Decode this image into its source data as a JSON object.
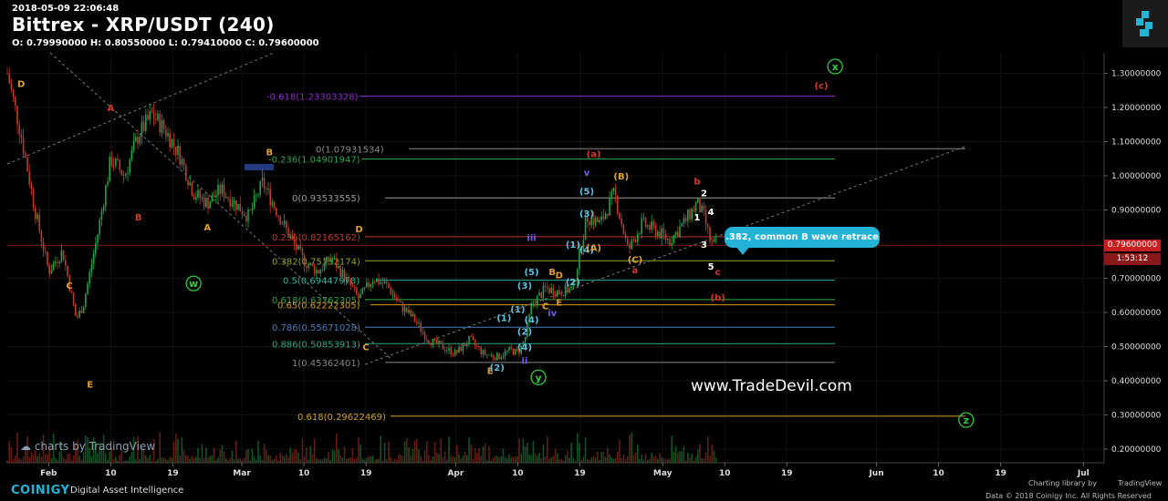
{
  "header": {
    "timestamp": "2018-05-09 22:06:48",
    "title": "Bittrex - XRP/USDT (240)",
    "ohlc": "O: 0.79990000 H: 0.80550000 L: 0.79410000 C: 0.79600000"
  },
  "footer": {
    "brand": "COINIGY",
    "tagline": "Digital Asset Intelligence",
    "charting_by": "Charting library by",
    "tradingview": "TradingView",
    "copyright": "Data © 2018 Coinigy Inc. All Rights Reserved"
  },
  "watermark": "charts by TradingView",
  "site": "www.TradeDevil.com",
  "callout": ".382, common B wave retrace",
  "current_price": {
    "label": "0.79600000",
    "countdown": "1:53:12"
  },
  "colors": {
    "up": "#1fa34a",
    "down": "#c0392b",
    "accent": "#23b3d7",
    "price_line": "#c71f1f"
  },
  "chart_data": {
    "type": "candlestick",
    "y_axis": {
      "min": 0.16,
      "max": 1.36,
      "ticks": [
        "1.30000000",
        "1.20000000",
        "1.10000000",
        "1.00000000",
        "0.90000000",
        "0.80000000",
        "0.70000000",
        "0.60000000",
        "0.50000000",
        "0.40000000",
        "0.30000000",
        "0.20000000"
      ]
    },
    "x_axis": {
      "ticks": [
        "Feb",
        "10",
        "19",
        "Mar",
        "10",
        "19",
        "Apr",
        "10",
        "19",
        "May",
        "10",
        "19",
        "Jun",
        "10",
        "19",
        "Jul"
      ]
    },
    "price_path": [
      [
        "2018-01-26",
        1.3
      ],
      [
        "2018-01-28",
        1.12
      ],
      [
        "2018-01-30",
        0.9
      ],
      [
        "2018-02-01",
        0.72
      ],
      [
        "2018-02-03",
        0.78
      ],
      [
        "2018-02-05",
        0.58
      ],
      [
        "2018-02-06",
        0.62
      ],
      [
        "2018-02-08",
        0.82
      ],
      [
        "2018-02-10",
        1.05
      ],
      [
        "2018-02-12",
        1.0
      ],
      [
        "2018-02-14",
        1.12
      ],
      [
        "2018-02-16",
        1.18
      ],
      [
        "2018-02-18",
        1.13
      ],
      [
        "2018-02-20",
        1.06
      ],
      [
        "2018-02-22",
        0.95
      ],
      [
        "2018-02-24",
        0.92
      ],
      [
        "2018-02-26",
        0.96
      ],
      [
        "2018-02-28",
        0.92
      ],
      [
        "2018-03-02",
        0.88
      ],
      [
        "2018-03-04",
        0.98
      ],
      [
        "2018-03-06",
        0.9
      ],
      [
        "2018-03-08",
        0.82
      ],
      [
        "2018-03-10",
        0.75
      ],
      [
        "2018-03-12",
        0.72
      ],
      [
        "2018-03-14",
        0.76
      ],
      [
        "2018-03-16",
        0.7
      ],
      [
        "2018-03-18",
        0.64
      ],
      [
        "2018-03-20",
        0.7
      ],
      [
        "2018-03-22",
        0.68
      ],
      [
        "2018-03-24",
        0.62
      ],
      [
        "2018-03-26",
        0.58
      ],
      [
        "2018-03-28",
        0.52
      ],
      [
        "2018-03-30",
        0.5
      ],
      [
        "2018-04-01",
        0.48
      ],
      [
        "2018-04-03",
        0.52
      ],
      [
        "2018-04-05",
        0.48
      ],
      [
        "2018-04-07",
        0.47
      ],
      [
        "2018-04-09",
        0.49
      ],
      [
        "2018-04-10",
        0.48
      ],
      [
        "2018-04-11",
        0.52
      ],
      [
        "2018-04-12",
        0.62
      ],
      [
        "2018-04-14",
        0.67
      ],
      [
        "2018-04-16",
        0.66
      ],
      [
        "2018-04-18",
        0.67
      ],
      [
        "2018-04-20",
        0.88
      ],
      [
        "2018-04-22",
        0.86
      ],
      [
        "2018-04-24",
        0.95
      ],
      [
        "2018-04-26",
        0.78
      ],
      [
        "2018-04-28",
        0.86
      ],
      [
        "2018-04-30",
        0.84
      ],
      [
        "2018-05-02",
        0.81
      ],
      [
        "2018-05-04",
        0.86
      ],
      [
        "2018-05-06",
        0.92
      ],
      [
        "2018-05-07",
        0.88
      ],
      [
        "2018-05-08",
        0.8
      ],
      [
        "2018-05-09",
        0.796
      ]
    ],
    "fib_levels": [
      {
        "label": "-0.618(1.23303328)",
        "value": 1.23303328,
        "color": "#8e2bd6"
      },
      {
        "label": "0(1.07931534)",
        "value": 1.07931534,
        "color": "#888888"
      },
      {
        "label": "-0.236(1.04901947)",
        "value": 1.04901947,
        "color": "#2ea84a"
      },
      {
        "label": "0(0.93533555)",
        "value": 0.93533555,
        "color": "#9a9a9a"
      },
      {
        "label": "0.236(0.82165162)",
        "value": 0.82165162,
        "color": "#c0392b"
      },
      {
        "label": "0.382(0.75132174)",
        "value": 0.75132174,
        "color": "#8fa52a"
      },
      {
        "label": "0.5(0.69447978)",
        "value": 0.69447978,
        "color": "#27b5a0"
      },
      {
        "label": "0.618(0.63762305)",
        "value": 0.63762305,
        "color": "#2ba84a"
      },
      {
        "label": "0.65(0.62222305)",
        "value": 0.62222305,
        "color": "#d49a1e"
      },
      {
        "label": "0.786(0.55671028)",
        "value": 0.55671028,
        "color": "#4a7ec0"
      },
      {
        "label": "0.886(0.50853913)",
        "value": 0.50853913,
        "color": "#2ea88a"
      },
      {
        "label": "1(0.45362401)",
        "value": 0.45362401,
        "color": "#888888"
      },
      {
        "label": "0.618(0.29622469)",
        "value": 0.29622469,
        "color": "#d4a020"
      }
    ],
    "wave_labels": [
      {
        "text": "D",
        "x": "2018-01-28",
        "y": 1.26,
        "color": "#e0a030"
      },
      {
        "text": "C",
        "x": "2018-02-04",
        "y": 0.67,
        "color": "#e0a030"
      },
      {
        "text": "E",
        "x": "2018-02-07",
        "y": 0.38,
        "color": "#e0a030"
      },
      {
        "text": "A",
        "x": "2018-02-10",
        "y": 1.19,
        "color": "#d23a2a"
      },
      {
        "text": "B",
        "x": "2018-02-14",
        "y": 0.87,
        "color": "#d23a2a"
      },
      {
        "text": "A",
        "x": "2018-02-24",
        "y": 0.84,
        "color": "#e0a030"
      },
      {
        "text": "B",
        "x": "2018-03-05",
        "y": 1.06,
        "color": "#e0a030"
      },
      {
        "text": "D",
        "x": "2018-03-18",
        "y": 0.835,
        "color": "#e0a030"
      },
      {
        "text": "C",
        "x": "2018-03-19",
        "y": 0.49,
        "color": "#e0a030"
      },
      {
        "text": "E",
        "x": "2018-04-06",
        "y": 0.42,
        "color": "#e0a030"
      },
      {
        "text": "iii",
        "x": "2018-04-12",
        "y": 0.81,
        "color": "#6c5ce7"
      },
      {
        "text": "iv",
        "x": "2018-04-15",
        "y": 0.59,
        "color": "#6c5ce7"
      },
      {
        "text": "ii",
        "x": "2018-04-11",
        "y": 0.45,
        "color": "#6c5ce7"
      },
      {
        "text": "v",
        "x": "2018-04-20",
        "y": 1.0,
        "color": "#6c5ce7"
      },
      {
        "text": "(5)",
        "x": "2018-04-20",
        "y": 0.945,
        "color": "#5fc0e0"
      },
      {
        "text": "(3)",
        "x": "2018-04-20",
        "y": 0.88,
        "color": "#5fc0e0"
      },
      {
        "text": "(1)",
        "x": "2018-04-18",
        "y": 0.79,
        "color": "#5fc0e0"
      },
      {
        "text": "(4)",
        "x": "2018-04-20",
        "y": 0.775,
        "color": "#5fc0e0"
      },
      {
        "text": "(5)",
        "x": "2018-04-12",
        "y": 0.71,
        "color": "#5fc0e0"
      },
      {
        "text": "(3)",
        "x": "2018-04-11",
        "y": 0.67,
        "color": "#5fc0e0"
      },
      {
        "text": "(1)",
        "x": "2018-04-10",
        "y": 0.6,
        "color": "#5fc0e0"
      },
      {
        "text": "(4)",
        "x": "2018-04-12",
        "y": 0.57,
        "color": "#5fc0e0"
      },
      {
        "text": "(2)",
        "x": "2018-04-11",
        "y": 0.535,
        "color": "#5fc0e0"
      },
      {
        "text": "(1)",
        "x": "2018-04-08",
        "y": 0.575,
        "color": "#5fc0e0"
      },
      {
        "text": "(4)",
        "x": "2018-04-11",
        "y": 0.49,
        "color": "#5fc0e0"
      },
      {
        "text": "(2)",
        "x": "2018-04-07",
        "y": 0.43,
        "color": "#5fc0e0"
      },
      {
        "text": "(2)",
        "x": "2018-04-18",
        "y": 0.68,
        "color": "#5fc0e0"
      },
      {
        "text": "B",
        "x": "2018-04-15",
        "y": 0.71,
        "color": "#e0a030"
      },
      {
        "text": "D",
        "x": "2018-04-16",
        "y": 0.7,
        "color": "#e0a030"
      },
      {
        "text": "C",
        "x": "2018-04-14",
        "y": 0.61,
        "color": "#e0a030"
      },
      {
        "text": "E",
        "x": "2018-04-16",
        "y": 0.62,
        "color": "#e0a030"
      },
      {
        "text": "(A)",
        "x": "2018-04-21",
        "y": 0.78,
        "color": "#e0a030"
      },
      {
        "text": "(B)",
        "x": "2018-04-25",
        "y": 0.99,
        "color": "#e0a030"
      },
      {
        "text": "(C)",
        "x": "2018-04-27",
        "y": 0.745,
        "color": "#e0a030"
      },
      {
        "text": "(a)",
        "x": "2018-04-21",
        "y": 1.055,
        "color": "#d23a2a"
      },
      {
        "text": "a",
        "x": "2018-04-27",
        "y": 0.715,
        "color": "#d23a2a"
      },
      {
        "text": "b",
        "x": "2018-05-06",
        "y": 0.975,
        "color": "#d23a2a"
      },
      {
        "text": "c",
        "x": "2018-05-09",
        "y": 0.71,
        "color": "#d23a2a"
      },
      {
        "text": "(b)",
        "x": "2018-05-09",
        "y": 0.635,
        "color": "#d23a2a"
      },
      {
        "text": "(c)",
        "x": "2018-05-24",
        "y": 1.255,
        "color": "#d23a2a"
      },
      {
        "text": "1",
        "x": "2018-05-06",
        "y": 0.87,
        "color": "#ffffff"
      },
      {
        "text": "2",
        "x": "2018-05-07",
        "y": 0.94,
        "color": "#ffffff"
      },
      {
        "text": "3",
        "x": "2018-05-07",
        "y": 0.79,
        "color": "#ffffff"
      },
      {
        "text": "4",
        "x": "2018-05-08",
        "y": 0.885,
        "color": "#ffffff"
      },
      {
        "text": "5",
        "x": "2018-05-08",
        "y": 0.725,
        "color": "#ffffff"
      }
    ],
    "circle_labels": [
      {
        "text": "w",
        "x": "2018-02-22",
        "y": 0.685
      },
      {
        "text": "y",
        "x": "2018-04-13",
        "y": 0.41
      },
      {
        "text": "x",
        "x": "2018-05-26",
        "y": 1.32
      },
      {
        "text": "z",
        "x": "2018-06-14",
        "y": 0.285
      }
    ]
  }
}
